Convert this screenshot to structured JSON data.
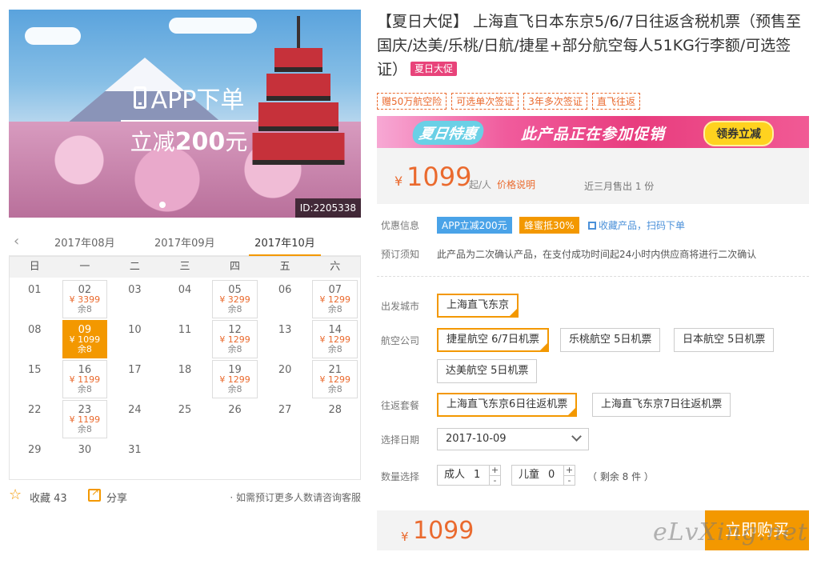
{
  "hero": {
    "app_text": "APP下单",
    "discount_prefix": "立减",
    "discount_amount": "200",
    "discount_suffix": "元",
    "product_id": "ID:2205338"
  },
  "calendar": {
    "months": [
      "2017年08月",
      "2017年09月",
      "2017年10月"
    ],
    "active_month": "2017年10月",
    "weekdays": [
      "日",
      "一",
      "二",
      "三",
      "四",
      "五",
      "六"
    ],
    "days": [
      {
        "d": "01"
      },
      {
        "d": "02",
        "price": "¥ 3399",
        "left": "余8"
      },
      {
        "d": "03"
      },
      {
        "d": "04"
      },
      {
        "d": "05",
        "price": "¥ 3299",
        "left": "余8"
      },
      {
        "d": "06"
      },
      {
        "d": "07",
        "price": "¥ 1299",
        "left": "余8"
      },
      {
        "d": "08"
      },
      {
        "d": "09",
        "price": "¥ 1099",
        "left": "余8",
        "selected": true
      },
      {
        "d": "10"
      },
      {
        "d": "11"
      },
      {
        "d": "12",
        "price": "¥ 1299",
        "left": "余8"
      },
      {
        "d": "13"
      },
      {
        "d": "14",
        "price": "¥ 1299",
        "left": "余8"
      },
      {
        "d": "15"
      },
      {
        "d": "16",
        "price": "¥ 1199",
        "left": "余8"
      },
      {
        "d": "17"
      },
      {
        "d": "18"
      },
      {
        "d": "19",
        "price": "¥ 1299",
        "left": "余8"
      },
      {
        "d": "20"
      },
      {
        "d": "21",
        "price": "¥ 1299",
        "left": "余8"
      },
      {
        "d": "22"
      },
      {
        "d": "23",
        "price": "¥ 1199",
        "left": "余8"
      },
      {
        "d": "24"
      },
      {
        "d": "25"
      },
      {
        "d": "26"
      },
      {
        "d": "27"
      },
      {
        "d": "28"
      },
      {
        "d": "29"
      },
      {
        "d": "30"
      },
      {
        "d": "31"
      }
    ]
  },
  "share": {
    "favorite_label": "收藏",
    "favorite_count": "43",
    "share_label": "分享",
    "note": "· 如需预订更多人数请咨询客服"
  },
  "product": {
    "title": "【夏日大促】 上海直飞日本东京5/6/7日往返含税机票（预售至国庆/达美/乐桃/日航/捷星+部分航空每人51KG行李额/可选签证）",
    "title_badge": "夏日大促",
    "tags": [
      "赠50万航空险",
      "可选单次签证",
      "3年多次签证",
      "直飞往返"
    ]
  },
  "promo": {
    "summer_label": "夏日特惠",
    "text": "此产品正在参加促销",
    "button": "领券立减",
    "colors": {
      "accent": "#e83d7e",
      "button": "#ffd21f"
    }
  },
  "price": {
    "currency": "¥",
    "amount": "1099",
    "unit": "起/人",
    "explain": "价格说明",
    "sold": "近三月售出 1 份"
  },
  "offers": {
    "label": "优惠信息",
    "app_discount": "APP立减200元",
    "honey": "蜂蜜抵30%",
    "qr": "收藏产品，扫码下单"
  },
  "notice": {
    "label": "预订须知",
    "text": "此产品为二次确认产品，在支付成功时间起24小时内供应商将进行二次确认"
  },
  "options": {
    "departure_label": "出发城市",
    "departure": [
      "上海直飞东京"
    ],
    "airline_label": "航空公司",
    "airlines": [
      "捷星航空 6/7日机票",
      "乐桃航空 5日机票",
      "日本航空 5日机票",
      "达美航空 5日机票"
    ],
    "package_label": "往返套餐",
    "packages": [
      "上海直飞东京6日往返机票",
      "上海直飞东京7日往返机票"
    ],
    "date_label": "选择日期",
    "date_value": "2017-10-09",
    "qty_label": "数量选择",
    "adult_label": "成人",
    "adult_value": "1",
    "child_label": "儿童",
    "child_value": "0",
    "remain": "（ 剩余 8 件 ）"
  },
  "buy": {
    "currency": "¥",
    "amount": "1099",
    "button": "立即购买"
  },
  "watermark": "eLvXing.net",
  "colors": {
    "accent": "#f39800",
    "price": "#ea6a2e",
    "link": "#4a90d9"
  }
}
